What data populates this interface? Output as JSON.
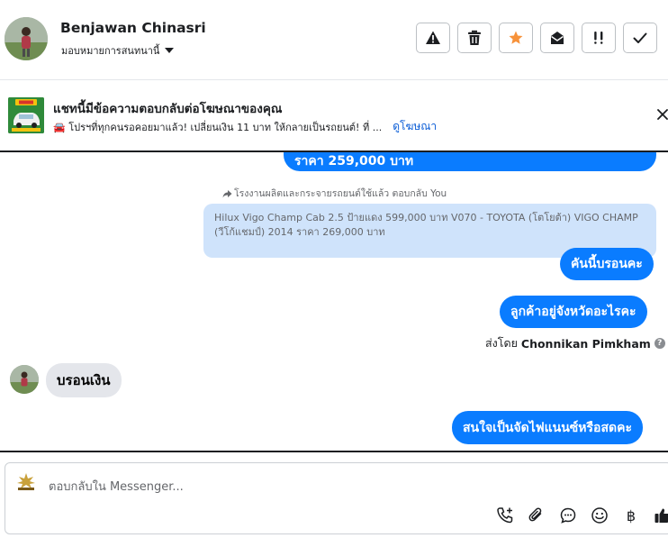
{
  "header": {
    "contact_name": "Benjawan Chinasri",
    "assign_label": "มอบหมายการสนทนานี้",
    "actions": [
      "spam-icon",
      "trash-icon",
      "star-icon",
      "mark-unread-icon",
      "follow-up-icon",
      "done-icon"
    ]
  },
  "ad_banner": {
    "title": "แชทนี้มีข้อความตอบกลับต่อโฆษณาของคุณ",
    "subtitle": "🚘 โปรฯที่ทุกคนรอคอยมาแล้ว! เปลี่ยนเงิน 11 บาท ให้กลายเป็นรถยนต์! ที่ ...",
    "link": "ดูโฆษณา"
  },
  "messages": {
    "price_cut": "ราคา 259,000 บาท",
    "reply_label": "โรงงานผลิตและกระจายรถยนต์ใช้แล้ว ตอบกลับ You",
    "quoted_text": "Hilux Vigo Champ Cab 2.5 ป้ายแดง 599,000 บาท  V070 - TOYOTA (โตโยต้า) VIGO CHAMP (วีโก้แชมป์) 2014 ราคา 269,000 บาท",
    "msg_1": "คันนี้บรอนคะ",
    "msg_2": "ลูกค้าอยู่จังหวัดอะไรคะ",
    "sent_by_prefix": "ส่งโดย",
    "sent_by_name": "Chonnikan Pimkham",
    "help": "?",
    "incoming_1": "บรอนเงิน",
    "msg_3": "สนใจเป็นจัดไฟแนนซ์หรือสดคะ"
  },
  "composer": {
    "placeholder": "ตอบกลับใน Messenger...",
    "tools": [
      "call-add-icon",
      "attachment-icon",
      "saved-reply-icon",
      "emoji-icon",
      "baht-icon",
      "like-icon"
    ],
    "baht": "฿"
  },
  "colors": {
    "accent": "#0a7cff",
    "quoted_bg": "#cfe3fb",
    "incoming_bg": "#e4e6eb",
    "star": "#f7923a",
    "link": "#0a5cd6"
  }
}
